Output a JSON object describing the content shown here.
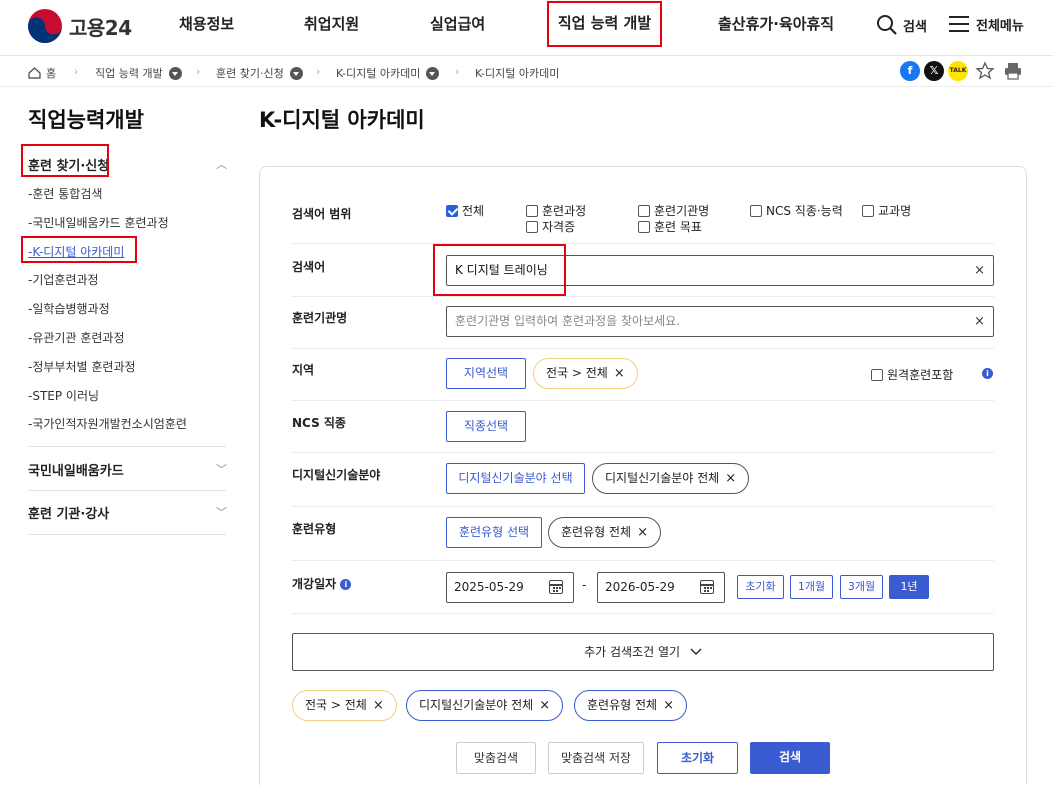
{
  "header": {
    "logo_text": "고용24",
    "nav": [
      "채용정보",
      "취업지원",
      "실업급여",
      "직업 능력 개발",
      "출산휴가·육아휴직"
    ],
    "search_label": "검색",
    "menu_label": "전체메뉴"
  },
  "breadcrumb": {
    "home": "홈",
    "items": [
      "직업 능력 개발",
      "훈련 찾기·신청",
      "K-디지털 아카데미",
      "K-디지털 아카데미"
    ]
  },
  "share": {
    "facebook": "f",
    "x": "𝕏",
    "kakao": "TALK"
  },
  "sidebar": {
    "title": "직업능력개발",
    "group1": "훈련 찾기·신청",
    "sub_items": [
      "훈련 통합검색",
      "국민내일배움카드 훈련과정",
      "K-디지털 아카데미",
      "기업훈련과정",
      "일학습병행과정",
      "유관기관 훈련과정",
      "정부부처별 훈련과정",
      "STEP 이러닝",
      "국가인적자원개발컨소시엄훈련"
    ],
    "group2": "국민내일배움카드",
    "group3": "훈련 기관·강사"
  },
  "main": {
    "title": "K-디지털 아카데미",
    "scope_label": "검색어 범위",
    "scope_options": [
      "전체",
      "훈련과정",
      "훈련기관명",
      "NCS 직종·능력",
      "교과명",
      "자격증",
      "훈련 목표"
    ],
    "keyword_label": "검색어",
    "keyword_value": "K 디지털 트레이닝",
    "org_label": "훈련기관명",
    "org_placeholder": "훈련기관명 입력하여 훈련과정을 찾아보세요.",
    "region_label": "지역",
    "region_button": "지역선택",
    "region_chip": "전국 > 전체",
    "remote_label": "원격훈련포함",
    "ncs_label": "NCS 직종",
    "ncs_button": "직종선택",
    "digital_label": "디지털신기술분야",
    "digital_button": "디지털신기술분야 선택",
    "digital_chip": "디지털신기술분야 전체",
    "type_label": "훈련유형",
    "type_button": "훈련유형 선택",
    "type_chip": "훈련유형 전체",
    "date_label": "개강일자",
    "date_from": "2025-05-29",
    "date_sep": "-",
    "date_to": "2026-05-29",
    "date_buttons": [
      "초기화",
      "1개월",
      "3개월",
      "1년"
    ],
    "more_conditions": "추가 검색조건 열기",
    "selected_chips": [
      "전국 > 전체",
      "디지털신기술분야 전체",
      "훈련유형 전체"
    ],
    "actions": [
      "맞춤검색",
      "맞춤검색 저장",
      "초기화",
      "검색"
    ]
  },
  "colors": {
    "accent": "#3a5bd1",
    "highlight": "#e60012",
    "chip_yellow": "#f0d080"
  }
}
